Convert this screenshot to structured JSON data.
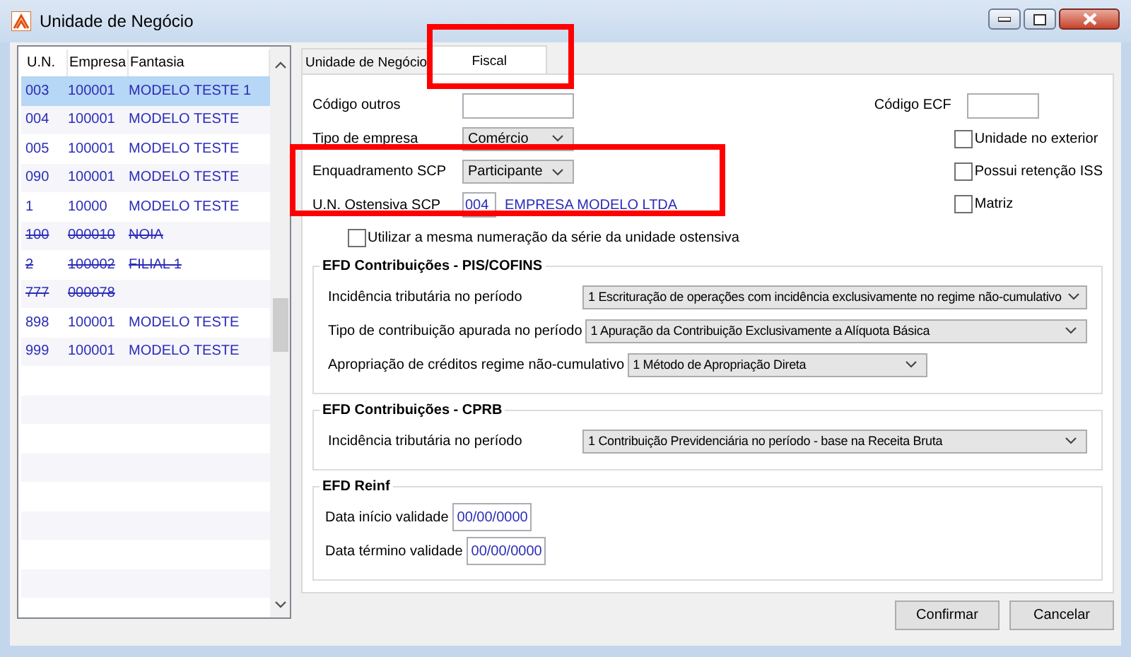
{
  "window": {
    "title": "Unidade de Negócio"
  },
  "list": {
    "columns": [
      "U.N.",
      "Empresa",
      "Fantasia"
    ],
    "rows": [
      {
        "un": "003",
        "empresa": "100001",
        "fantasia": "MODELO TESTE 1",
        "selected": true,
        "deleted": false
      },
      {
        "un": "004",
        "empresa": "100001",
        "fantasia": "MODELO TESTE",
        "selected": false,
        "deleted": false
      },
      {
        "un": "005",
        "empresa": "100001",
        "fantasia": "MODELO TESTE",
        "selected": false,
        "deleted": false
      },
      {
        "un": "090",
        "empresa": "100001",
        "fantasia": "MODELO TESTE",
        "selected": false,
        "deleted": false
      },
      {
        "un": "1",
        "empresa": "10000",
        "fantasia": "MODELO TESTE",
        "selected": false,
        "deleted": false
      },
      {
        "un": "100",
        "empresa": "000010",
        "fantasia": "NOIA",
        "selected": false,
        "deleted": true
      },
      {
        "un": "2",
        "empresa": "100002",
        "fantasia": "FILIAL 1",
        "selected": false,
        "deleted": true
      },
      {
        "un": "777",
        "empresa": "000078",
        "selected": false,
        "deleted": true
      },
      {
        "un": "898",
        "empresa": "100001",
        "fantasia": "MODELO TESTE",
        "selected": false,
        "deleted": false
      },
      {
        "un": "999",
        "empresa": "100001",
        "fantasia": "MODELO TESTE",
        "selected": false,
        "deleted": false
      }
    ]
  },
  "tabs": [
    {
      "label": "Unidade de Negócio",
      "selected": false
    },
    {
      "label": "Fiscal",
      "selected": true
    }
  ],
  "fiscal": {
    "codigo_outros": {
      "label": "Código outros"
    },
    "tipo_empresa": {
      "label": "Tipo de empresa",
      "value": "Comércio"
    },
    "enquadramento_scp": {
      "label": "Enquadramento SCP",
      "value": "Participante"
    },
    "un_ostensiva_scp": {
      "label": "U.N. Ostensiva SCP",
      "code": "004",
      "name": "EMPRESA MODELO LTDA"
    },
    "codigo_ecf": {
      "label": "Código ECF"
    },
    "options": [
      {
        "label": "Unidade no exterior",
        "checked": false
      },
      {
        "label": "Possui retenção ISS",
        "checked": false
      },
      {
        "label": "Matriz",
        "checked": false
      }
    ],
    "mesma_numeracao": {
      "label": "Utilizar a mesma numeração da série da unidade ostensiva",
      "checked": false
    }
  },
  "groups": [
    {
      "title": "EFD Contribuições - PIS/COFINS",
      "rows": [
        {
          "kind": "select",
          "label": "Incidência tributária no período",
          "value": "1 Escrituração de operações com incidência exclusivamente no regime não-cumulativo"
        },
        {
          "kind": "select",
          "label": "Tipo de contribuição apurada no período",
          "value": "1 Apuração da Contribuição Exclusivamente a Alíquota Básica"
        },
        {
          "kind": "select",
          "label": "Apropriação de créditos regime não-cumulativo",
          "value": "1 Método de Apropriação Direta"
        }
      ]
    },
    {
      "title": "EFD Contribuições - CPRB",
      "rows": [
        {
          "kind": "select",
          "label": "Incidência tributária no período",
          "value": "1 Contribuição Previdenciária no período - base na Receita Bruta"
        }
      ]
    },
    {
      "title": "EFD Reinf",
      "rows": [
        {
          "kind": "date",
          "label": "Data início validade",
          "value": "00/00/0000"
        },
        {
          "kind": "date",
          "label": "Data término validade",
          "value": "00/00/0000"
        }
      ]
    }
  ],
  "buttons": [
    "Confirmar",
    "Cancelar"
  ]
}
